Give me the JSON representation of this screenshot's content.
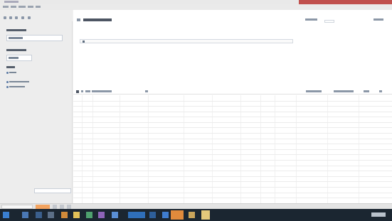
{
  "window": {
    "title": ""
  },
  "menu": {
    "items": [
      "",
      "",
      "",
      "",
      ""
    ]
  },
  "sidebar": {
    "sections": [
      {
        "heading": "",
        "box": ""
      },
      {
        "heading": "",
        "box": ""
      },
      {
        "heading": "",
        "items": [
          "",
          ""
        ]
      }
    ],
    "search_placeholder": ""
  },
  "sheet": {
    "title": "",
    "filter_text": ""
  },
  "grid": {
    "columns": [
      "",
      "",
      "",
      "",
      "",
      "",
      "",
      "",
      "",
      "",
      "",
      "",
      ""
    ],
    "rows": [
      [
        "",
        "",
        "",
        "",
        "",
        "",
        "",
        "",
        "",
        "",
        "",
        "",
        ""
      ],
      [
        "",
        "",
        "",
        "",
        "",
        "",
        "",
        "",
        "",
        "",
        "",
        "",
        ""
      ],
      [
        "",
        "",
        "",
        "",
        "",
        "",
        "",
        "",
        "",
        "",
        "",
        "",
        ""
      ],
      [
        "",
        "",
        "",
        "",
        "",
        "",
        "",
        "",
        "",
        "",
        "",
        "",
        ""
      ],
      [
        "",
        "",
        "",
        "",
        "",
        "",
        "",
        "",
        "",
        "",
        "",
        "",
        ""
      ],
      [
        "",
        "",
        "",
        "",
        "",
        "",
        "",
        "",
        "",
        "",
        "",
        "",
        ""
      ],
      [
        "",
        "",
        "",
        "",
        "",
        "",
        "",
        "",
        "",
        "",
        "",
        "",
        ""
      ],
      [
        "",
        "",
        "",
        "",
        "",
        "",
        "",
        "",
        "",
        "",
        "",
        "",
        ""
      ],
      [
        "",
        "",
        "",
        "",
        "",
        "",
        "",
        "",
        "",
        "",
        "",
        "",
        ""
      ],
      [
        "",
        "",
        "",
        "",
        "",
        "",
        "",
        "",
        "",
        "",
        "",
        "",
        ""
      ],
      [
        "",
        "",
        "",
        "",
        "",
        "",
        "",
        "",
        "",
        "",
        "",
        "",
        ""
      ],
      [
        "",
        "",
        "",
        "",
        "",
        "",
        "",
        "",
        "",
        "",
        "",
        "",
        ""
      ],
      [
        "",
        "",
        "",
        "",
        "",
        "",
        "",
        "",
        "",
        "",
        "",
        "",
        ""
      ],
      [
        "",
        "",
        "",
        "",
        "",
        "",
        "",
        "",
        "",
        "",
        "",
        "",
        ""
      ],
      [
        "",
        "",
        "",
        "",
        "",
        "",
        "",
        "",
        "",
        "",
        "",
        "",
        ""
      ],
      [
        "",
        "",
        "",
        "",
        "",
        "",
        "",
        "",
        "",
        "",
        "",
        "",
        ""
      ],
      [
        "",
        "",
        "",
        "",
        "",
        "",
        "",
        "",
        "",
        "",
        "",
        "",
        ""
      ],
      [
        "",
        "",
        "",
        "",
        "",
        "",
        "",
        "",
        "",
        "",
        "",
        "",
        ""
      ],
      [
        "",
        "",
        "",
        "",
        "",
        "",
        "",
        "",
        "",
        "",
        "",
        "",
        ""
      ],
      [
        "",
        "",
        "",
        "",
        "",
        "",
        "",
        "",
        "",
        "",
        "",
        "",
        ""
      ]
    ]
  },
  "status": {
    "tabs": [
      "",
      "",
      "",
      ""
    ]
  },
  "colors": {
    "accent": "#c0504d",
    "active_tab": "#f4a460",
    "taskbar": "#1b2631"
  }
}
